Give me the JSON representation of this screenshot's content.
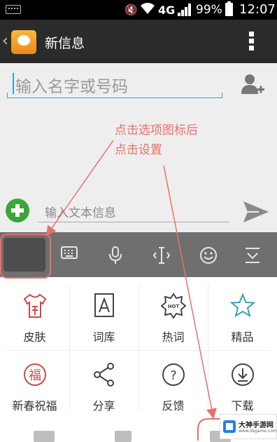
{
  "status_bar": {
    "network": "4G",
    "battery": "99%",
    "time": "12:07"
  },
  "title_bar": {
    "title": "新信息"
  },
  "compose": {
    "recipient_placeholder": "输入名字或号码",
    "message_placeholder": "输入文本信息"
  },
  "annotation": {
    "line1": "点击选项图标后",
    "line2": "点击设置"
  },
  "keyboard_toolbar": {
    "tools": [
      "options-icon",
      "keyboard-icon",
      "microphone-icon",
      "cursor-icon",
      "emoji-icon",
      "hide-keyboard-icon"
    ]
  },
  "keyboard_panel": {
    "items": [
      {
        "label": "皮肤",
        "icon": "skin-shirt-icon"
      },
      {
        "label": "词库",
        "icon": "dictionary-icon"
      },
      {
        "label": "热词",
        "icon": "hot-words-icon"
      },
      {
        "label": "精品",
        "icon": "star-icon"
      },
      {
        "label": "新春祝福",
        "icon": "blessing-icon"
      },
      {
        "label": "分享",
        "icon": "share-icon"
      },
      {
        "label": "反馈",
        "icon": "feedback-icon"
      },
      {
        "label": "下载",
        "icon": "download-icon"
      }
    ]
  },
  "watermark": {
    "name": "大神手游网",
    "url": "www.dsgame.com"
  },
  "colors": {
    "annotation": "#e8706a",
    "accent": "#28a7c9",
    "add_button": "#3ca53c"
  }
}
